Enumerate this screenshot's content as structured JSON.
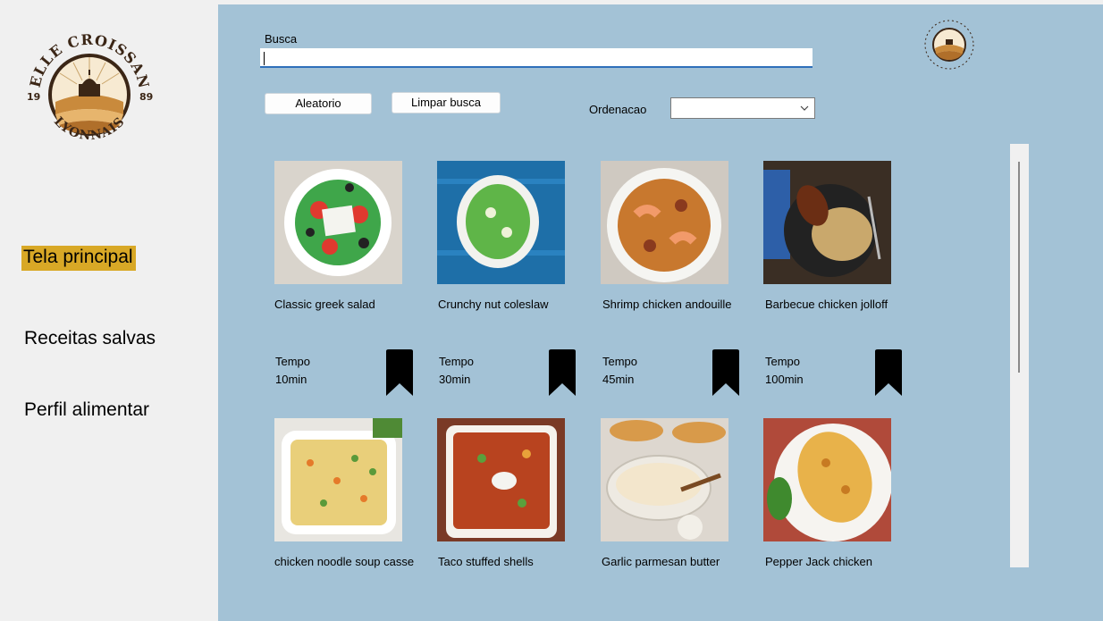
{
  "logo": {
    "top_text": "BELLE CROISSANT",
    "bottom_text": "LYONNAIS",
    "year_left": "19",
    "year_right": "89"
  },
  "nav": [
    {
      "label": "Tela principal",
      "active": true
    },
    {
      "label": "Receitas salvas",
      "active": false
    },
    {
      "label": "Perfil alimentar",
      "active": false
    }
  ],
  "search": {
    "label": "Busca",
    "value": ""
  },
  "buttons": {
    "random": "Aleatorio",
    "clear": "Limpar busca"
  },
  "sort": {
    "label": "Ordenacao",
    "value": ""
  },
  "recipes": [
    {
      "title": "Classic greek salad",
      "time_label": "Tempo",
      "time": "10min",
      "image": "greek-salad"
    },
    {
      "title": "Crunchy nut coleslaw",
      "time_label": "Tempo",
      "time": "30min",
      "image": "coleslaw"
    },
    {
      "title": "Shrimp chicken andouille",
      "time_label": "Tempo",
      "time": "45min",
      "image": "shrimp-jambalaya"
    },
    {
      "title": "Barbecue chicken jolloff",
      "time_label": "Tempo",
      "time": "100min",
      "image": "bbq-chicken-jollof"
    },
    {
      "title": "chicken noodle soup casse",
      "image": "noodle-casserole"
    },
    {
      "title": "Taco stuffed shells",
      "image": "taco-shells"
    },
    {
      "title": "Garlic parmesan butter",
      "image": "garlic-butter"
    },
    {
      "title": "Pepper Jack chicken",
      "image": "pepper-jack-chicken"
    }
  ],
  "colors": {
    "sidebar_bg": "#f0f0f0",
    "main_bg": "#a3c2d6",
    "active_nav": "#d8a826",
    "search_underline": "#2e6fba"
  }
}
